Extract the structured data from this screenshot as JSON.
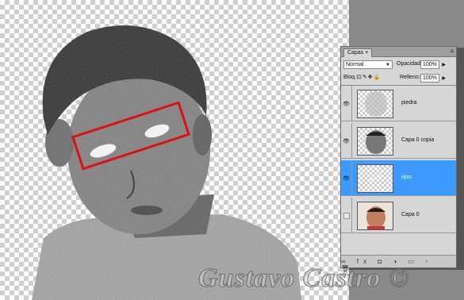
{
  "panel": {
    "tab_label": "Capas",
    "tab_close": "×",
    "menu_icon": "≡",
    "blend_mode": "Normal",
    "opacity_label": "Opacidad:",
    "opacity_value": "100%",
    "lock_label": "Bloq.:",
    "lock_icons": "⊡✎✥🔒",
    "fill_label": "Relleno:",
    "fill_value": "100%"
  },
  "layers": [
    {
      "name": "piedra",
      "visible": true,
      "active": false
    },
    {
      "name": "Capa 0 copia",
      "visible": true,
      "active": false
    },
    {
      "name": "ojos",
      "visible": true,
      "active": true
    },
    {
      "name": "Capa 0",
      "visible": false,
      "active": false
    }
  ],
  "footer_icons": "∞ fx ◘ ◑ ▭ ▫ 🗑",
  "watermark": "Gustavo Castro ©",
  "colors": {
    "accent": "#3d9bff",
    "highlight_box": "#e01010"
  }
}
